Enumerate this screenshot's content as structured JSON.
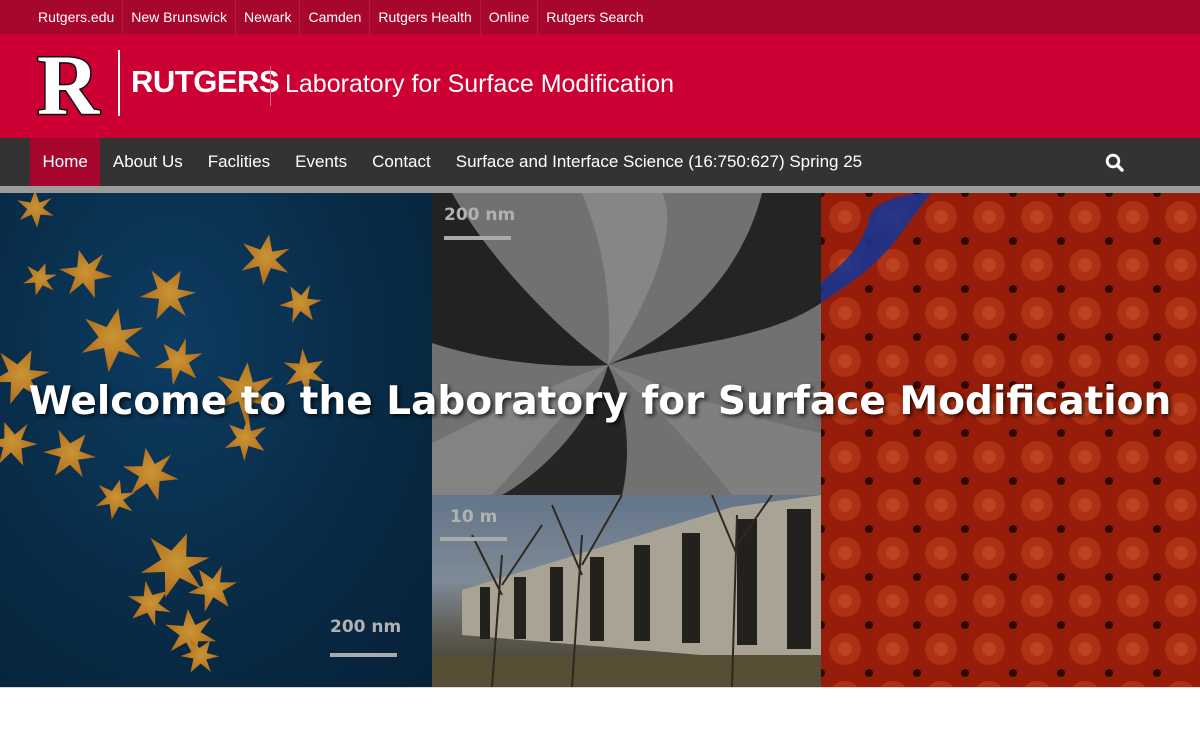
{
  "utility_nav": {
    "links": [
      "Rutgers.edu",
      "New Brunswick",
      "Newark",
      "Camden",
      "Rutgers Health",
      "Online",
      "Rutgers Search"
    ]
  },
  "header": {
    "logo_letter": "R",
    "wordmark": "RUTGERS",
    "site_title": "Laboratory for Surface Modification"
  },
  "main_nav": {
    "items": [
      "Home",
      "About Us",
      "Faclities",
      "Events",
      "Contact",
      "Surface and Interface Science (16:750:627) Spring 25"
    ],
    "active": "Home",
    "search_icon": "search-icon"
  },
  "hero": {
    "heading": "Welcome to the Laboratory for Surface Modification",
    "scale_labels": {
      "mid_top": "200 nm",
      "mid_bottom": "10 m",
      "left": "200 nm"
    }
  },
  "colors": {
    "utility_bar": "#a8072d",
    "header": "#cc0033",
    "nav": "#333333",
    "nav_active": "#a8072d"
  }
}
